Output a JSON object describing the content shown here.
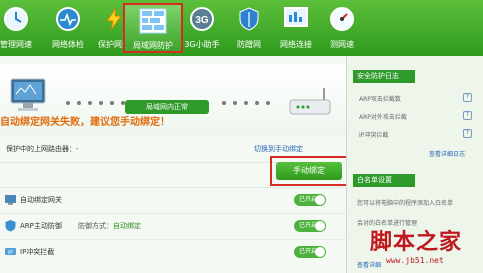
{
  "toolbar": {
    "items": [
      {
        "label": "管理网速",
        "icon": "clock-icon"
      },
      {
        "label": "网络体检",
        "icon": "pulse-icon"
      },
      {
        "label": "保护网速",
        "icon": "lightning-icon"
      },
      {
        "label": "局域网防护",
        "icon": "wall-icon",
        "active": true
      },
      {
        "label": "3G小助手",
        "icon": "3g-icon"
      },
      {
        "label": "防蹭网",
        "icon": "shield-icon"
      },
      {
        "label": "网络连接",
        "icon": "network-icon"
      },
      {
        "label": "测网速",
        "icon": "speedometer-icon"
      }
    ]
  },
  "status": {
    "pill": "局域网内正常"
  },
  "router": {
    "text": "保护中的上网路由器：-",
    "switch_link": "切换到手动绑定"
  },
  "warning": {
    "text": "自动绑定网关失败，建议您手动绑定！",
    "button": "手动绑定"
  },
  "rows": [
    {
      "name": "自动绑定网关",
      "sub_prefix": "",
      "sub_value": "",
      "toggle": "已开启"
    },
    {
      "name": "ARP主动防御",
      "sub_prefix": "防御方式：",
      "sub_value": "自动绑定",
      "toggle": "已开启"
    },
    {
      "name": "IP冲突拦截",
      "sub_prefix": "",
      "sub_value": "",
      "toggle": "已开启"
    }
  ],
  "sidebar": {
    "log_title": "安全防护日志",
    "log_items": [
      "ARP攻击拦截数",
      "ARP对外攻击拦截",
      "IP冲突拦截"
    ],
    "log_link": "查看详细日志",
    "whitelist_title": "白名单设置",
    "whitelist_text": "您可以将电脑中的程序添加入白名单",
    "whitelist_text2": "会对的白名单进行管理",
    "whitelist_link": "查看详细"
  },
  "watermark": {
    "big": "脚本之家",
    "url": "www.jb51.net"
  },
  "colors": {
    "brand_green": "#2e9a2a",
    "highlight_red": "#d62c22",
    "warning_orange": "#e06a0a"
  }
}
